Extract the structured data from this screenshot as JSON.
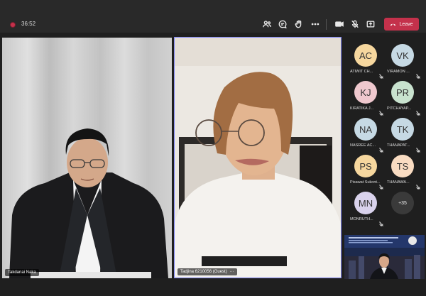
{
  "meeting": {
    "timer": "36:52"
  },
  "toolbar": {
    "icons": [
      "people-icon",
      "chat-icon",
      "raise-hand-icon",
      "more-icon",
      "camera-icon",
      "mic-off-icon",
      "share-icon"
    ],
    "leave_label": "Leave",
    "leave_color": "#c4314b"
  },
  "tiles": [
    {
      "name": "Takdanai Naka"
    },
    {
      "name": "Tadjina 6210056 (Guest)",
      "more": "···"
    }
  ],
  "participants": [
    {
      "initials": "AC",
      "name": "ATIWIT CH...",
      "color": "#f6d79e"
    },
    {
      "initials": "VK",
      "name": "VIRAMON ...",
      "color": "#c6d9e4"
    },
    {
      "initials": "KJ",
      "name": "KIRATIKA J...",
      "color": "#efc8ce"
    },
    {
      "initials": "PR",
      "name": "PITCHAYAP...",
      "color": "#c9e3cf"
    },
    {
      "initials": "NA",
      "name": "NASREE AC...",
      "color": "#c6d9e4"
    },
    {
      "initials": "TK",
      "name": "THANAPAT...",
      "color": "#c6d9e4"
    },
    {
      "initials": "PS",
      "name": "Pisawat Sukont...",
      "color": "#f6d79e"
    },
    {
      "initials": "TS",
      "name": "THANAWA...",
      "color": "#f9dcc2"
    },
    {
      "initials": "MN",
      "name": "MONRUTH...",
      "color": "#d9d2ec"
    }
  ],
  "overflow_count": "+35"
}
